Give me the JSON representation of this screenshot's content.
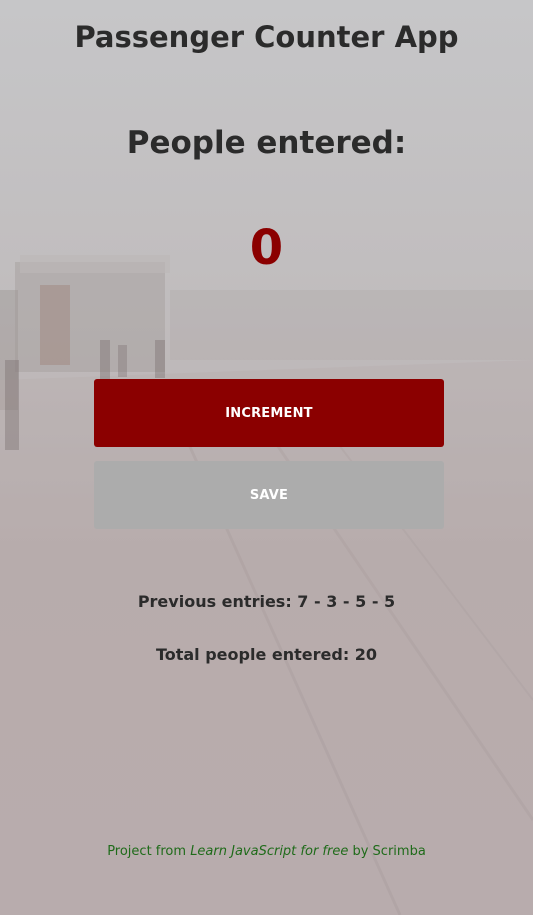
{
  "app": {
    "title": "Passenger Counter App"
  },
  "counter": {
    "heading": "People entered:",
    "value": "0"
  },
  "buttons": {
    "increment": "INCREMENT",
    "save": "SAVE"
  },
  "stats": {
    "previous_label": "Previous entries:",
    "previous_entries": "7 - 3 - 5 - 5",
    "total_label": "Total people entered:",
    "total_value": "20"
  },
  "footer": {
    "prefix": "Project from ",
    "course": "Learn JavaScript for free",
    "suffix": " by Scrimba"
  },
  "colors": {
    "accent": "#8b0000",
    "save_button": "#acacac",
    "footer_text": "#1f6b1a",
    "text": "#2b2b2b"
  }
}
